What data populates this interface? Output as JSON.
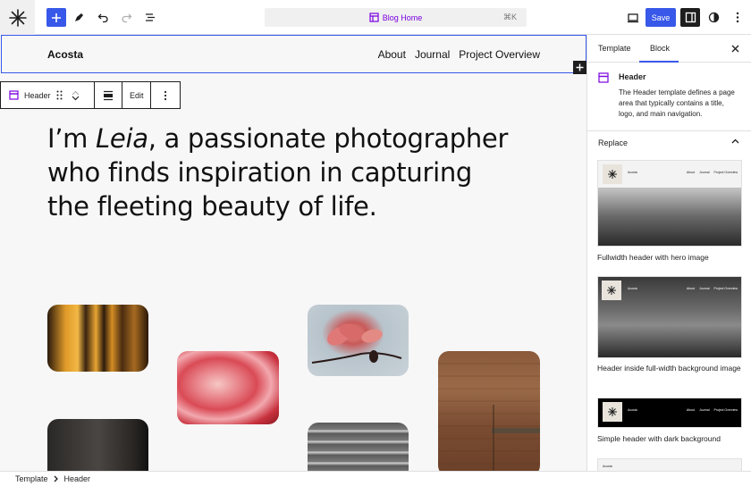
{
  "toolbar": {
    "command_title": "Blog Home",
    "command_shortcut": "⌘K",
    "save_label": "Save",
    "icons": [
      "wordpress-logo-icon",
      "plus-icon",
      "pen-icon",
      "undo-icon",
      "redo-icon",
      "list-view-icon",
      "template-icon",
      "desktop-view-icon",
      "sidebar-toggle-icon",
      "styles-icon",
      "more-vertical-icon"
    ]
  },
  "canvas": {
    "site_title": "Acosta",
    "nav": [
      "About",
      "Journal",
      "Project Overview"
    ],
    "block_toolbar": {
      "block_name": "Header",
      "edit_label": "Edit"
    },
    "hero": {
      "prefix": "I’m ",
      "name": "Leia",
      "rest": ", a passionate photographer who finds inspiration in capturing the fleeting beauty of life."
    },
    "photos": [
      "amber-light-window",
      "pink-flower-closeup",
      "magnolia-branch",
      "brick-wall",
      "stone-interior",
      "concrete-steps"
    ]
  },
  "sidebar": {
    "tabs": [
      "Template",
      "Block"
    ],
    "active_tab": "Block",
    "block": {
      "name": "Header",
      "description": "The Header template defines a page area that typically contains a title, logo, and main navigation."
    },
    "replace_heading": "Replace",
    "patterns": [
      {
        "label": "Fullwidth header with hero image",
        "site": "Acosta",
        "nav": [
          "About",
          "Journal",
          "Project Overview"
        ]
      },
      {
        "label": "Header inside full-width background image",
        "site": "Acosta",
        "nav": [
          "About",
          "Journal",
          "Project Overview"
        ]
      },
      {
        "label": "Simple header with dark background",
        "site": "Acosta",
        "nav": [
          "About",
          "Journal",
          "Project Overview"
        ]
      },
      {
        "label": "",
        "site": "Acosta",
        "nav": []
      }
    ]
  },
  "statusbar": {
    "crumbs": [
      "Template",
      "Header"
    ]
  },
  "colors": {
    "accent": "#3858e9",
    "template_purple": "#7a00df",
    "canvas_bg": "#f7f7f7",
    "dark": "#1e1e1e"
  }
}
